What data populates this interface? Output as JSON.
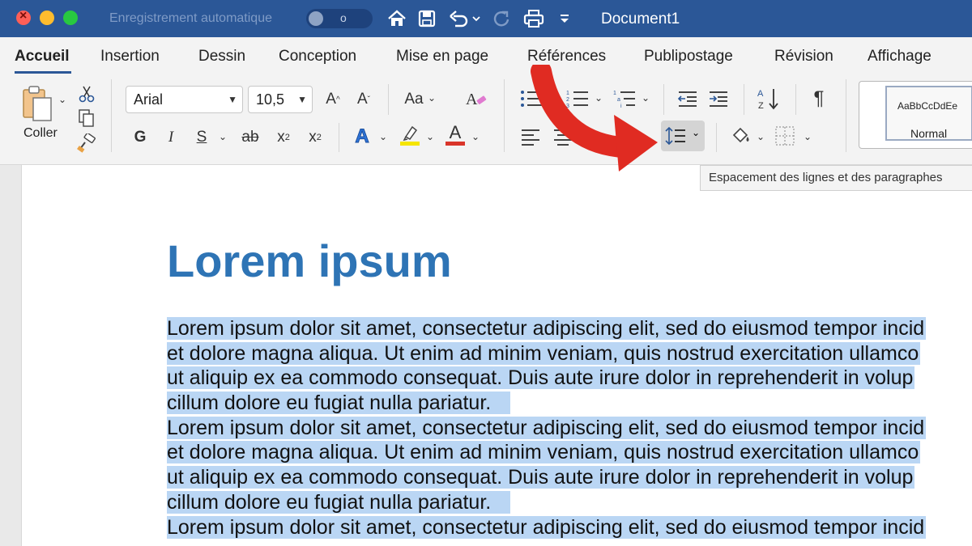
{
  "window": {
    "autosave_label": "Enregistrement automatique",
    "autosave_toggle_state": "o",
    "title": "Document1"
  },
  "tabs": [
    {
      "label": "Accueil",
      "active": true
    },
    {
      "label": "Insertion"
    },
    {
      "label": "Dessin"
    },
    {
      "label": "Conception"
    },
    {
      "label": "Mise en page"
    },
    {
      "label": "Références"
    },
    {
      "label": "Publipostage"
    },
    {
      "label": "Révision"
    },
    {
      "label": "Affichage"
    }
  ],
  "ribbon": {
    "paste_label": "Coller",
    "font_name": "Arial",
    "font_size": "10,5",
    "grow_font": "A",
    "shrink_font": "A",
    "change_case": "Aa",
    "bold": "G",
    "italic": "I",
    "underline": "S",
    "strikethrough": "ab",
    "subscript": "x",
    "subscript_mark": "2",
    "superscript": "x",
    "superscript_mark": "2",
    "text_effect": "A",
    "font_color": "A",
    "pilcrow": "¶",
    "style_sample": "AaBbCcDdEe",
    "style_name": "Normal"
  },
  "tooltip": "Espacement des lignes et des paragraphes",
  "document": {
    "heading": "Lorem ipsum",
    "paragraphs": [
      {
        "lines": [
          "Lorem ipsum dolor sit amet, consectetur adipiscing elit, sed do eiusmod tempor incid",
          "et dolore magna aliqua. Ut enim ad minim veniam, quis nostrud exercitation ullamco",
          "ut aliquip ex ea commodo consequat. Duis aute irure dolor in reprehenderit in volup",
          "cillum dolore eu fugiat nulla pariatur."
        ]
      },
      {
        "lines": [
          "Lorem ipsum dolor sit amet, consectetur adipiscing elit, sed do eiusmod tempor incid",
          "et dolore magna aliqua. Ut enim ad minim veniam, quis nostrud exercitation ullamco",
          "ut aliquip ex ea commodo consequat. Duis aute irure dolor in reprehenderit in volup",
          "cillum dolore eu fugiat nulla pariatur."
        ]
      },
      {
        "lines": [
          "Lorem ipsum dolor sit amet, consectetur adipiscing elit, sed do eiusmod tempor incid"
        ]
      }
    ]
  },
  "colors": {
    "title_bar": "#2b5797",
    "heading": "#2e74b5",
    "selection": "#bad6f4",
    "arrow": "#e02b22",
    "highlight_yellow": "#f5e500",
    "font_color_red": "#d9352a",
    "text_effect_blue": "#2e74d8"
  }
}
